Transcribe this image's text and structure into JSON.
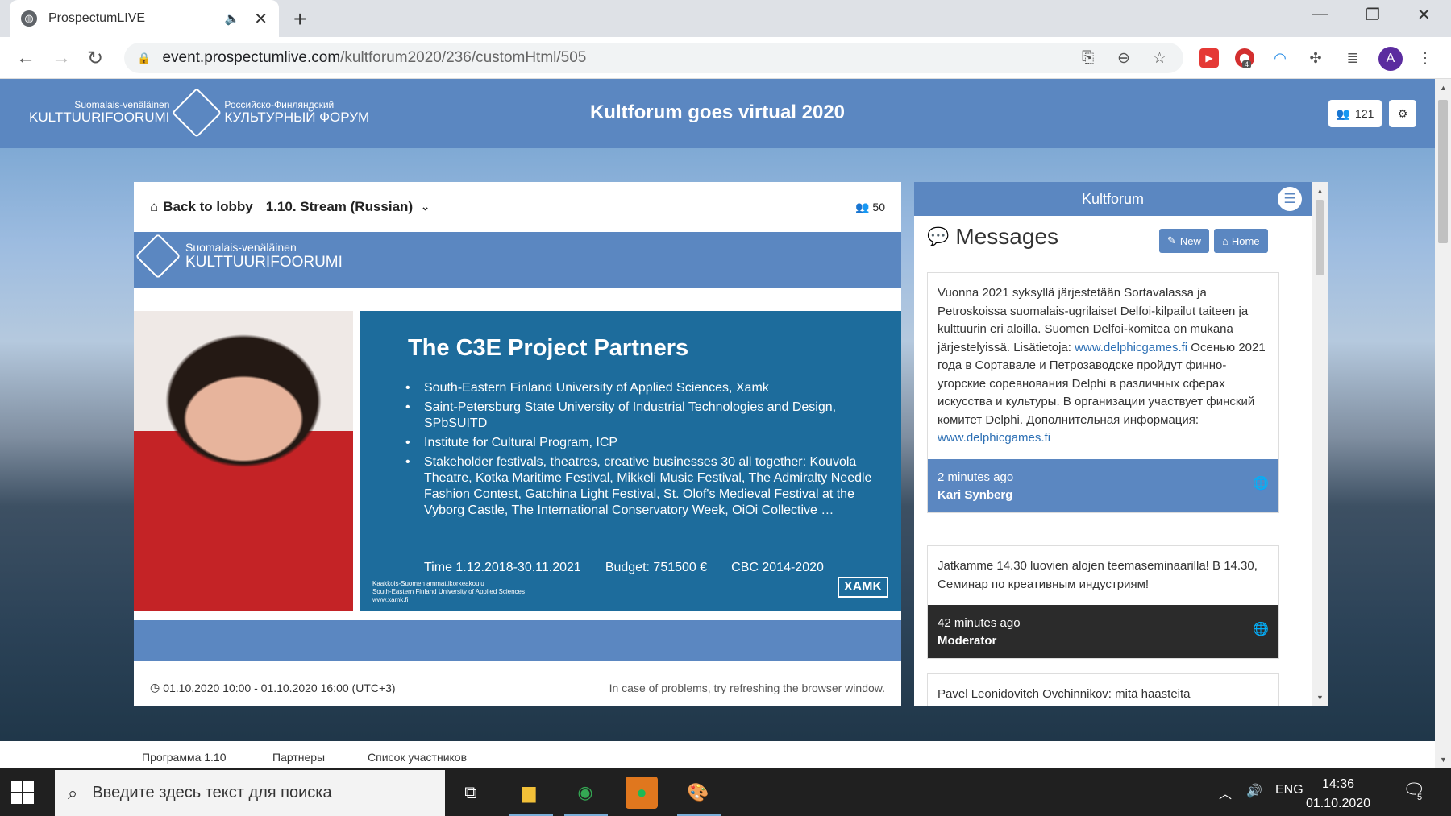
{
  "browser": {
    "tab_title": "ProspectumLIVE",
    "url_domain": "event.prospectumlive.com",
    "url_path": "/kultforum2020/236/customHtml/505",
    "ext_badge": "4",
    "avatar_letter": "A"
  },
  "header": {
    "logo_fi_small": "Suomalais-venäläinen",
    "logo_fi_big": "KULTTUURIFOORUMI",
    "logo_ru_small": "Российско-Финляндский",
    "logo_ru_big": "КУЛЬТУРНЫЙ ФОРУМ",
    "event_title": "Kultforum goes virtual 2020",
    "participants": "121"
  },
  "stream": {
    "back_label": "Back to lobby",
    "stream_name": "1.10. Stream (Russian)",
    "viewers": "50",
    "video_logo_small": "Suomalais-venäläinen",
    "video_logo_big": "KULTTUURIFOORUMI",
    "slide": {
      "title": "The C3E Project Partners",
      "bullets": [
        "South-Eastern Finland University of Applied Sciences, Xamk",
        "Saint-Petersburg State University of Industrial Technologies and Design, SPbSUITD",
        "Institute for Cultural Program, ICP",
        "Stakeholder festivals, theatres, creative businesses 30 all together: Kouvola Theatre, Kotka Maritime Festival, Mikkeli Music Festival, The Admiralty Needle Fashion Contest, Gatchina Light Festival, St. Olof's Medieval Festival at the Vyborg Castle, The International Conservatory Week, OiOi Collective …"
      ],
      "time": "Time 1.12.2018-30.11.2021",
      "budget": "Budget: 751500 €",
      "program": "CBC 2014-2020",
      "small_line1": "Kaakkois-Suomen ammattikorkeakoulu",
      "small_line2": "South-Eastern Finland University of Applied Sciences",
      "small_line3": "www.xamk.fi",
      "logo_text": "XAMK"
    },
    "schedule": "01.10.2020 10:00 - 01.10.2020 16:00 (UTC+3)",
    "hint": "In case of problems, try refreshing the browser window."
  },
  "chat": {
    "title": "Kultforum",
    "messages_heading": "Messages",
    "new_label": "New",
    "home_label": "Home",
    "cards": [
      {
        "text_a": "Vuonna 2021 syksyllä järjestetään Sortavalassa ja Petroskoissa suomalais-ugrilaiset Delfoi-kilpailut taiteen ja kulttuurin eri aloilla. Suomen Delfoi-komitea on mukana järjestelyissä. Lisätietoja: ",
        "link_a": "www.delphicgames.fi",
        "text_b": " Осенью 2021 года в Сортавале и Петрозаводске пройдут финно-угорские соревнования Delphi в различных сферах искусства и культуры. В организации участвует финский комитет Delphi. Дополнительная информация: ",
        "link_b": "www.delphicgames.fi",
        "time": "2 minutes ago",
        "author": "Kari Synberg",
        "foot_color": "#5b87c1"
      },
      {
        "text_a": "Jatkamme 14.30 luovien alojen teemaseminaarilla! В 14.30, Семинар по креативным индустриям!",
        "time": "42 minutes ago",
        "author": "Moderator",
        "foot_color": "#2b2b2b"
      },
      {
        "text_a": "Pavel Leonidovitch Ovchinnikov: mitä haasteita"
      }
    ]
  },
  "subnav": {
    "items": [
      "Программа 1.10",
      "Партнеры",
      "Список участников"
    ]
  },
  "taskbar": {
    "search_placeholder": "Введите здесь текст для поиска",
    "lang": "ENG",
    "time": "14:36",
    "date": "01.10.2020",
    "notif_count": "5"
  },
  "colors": {
    "brand_blue": "#5b87c1",
    "slide_blue": "#1d6c9c",
    "link": "#2c6fb4"
  }
}
